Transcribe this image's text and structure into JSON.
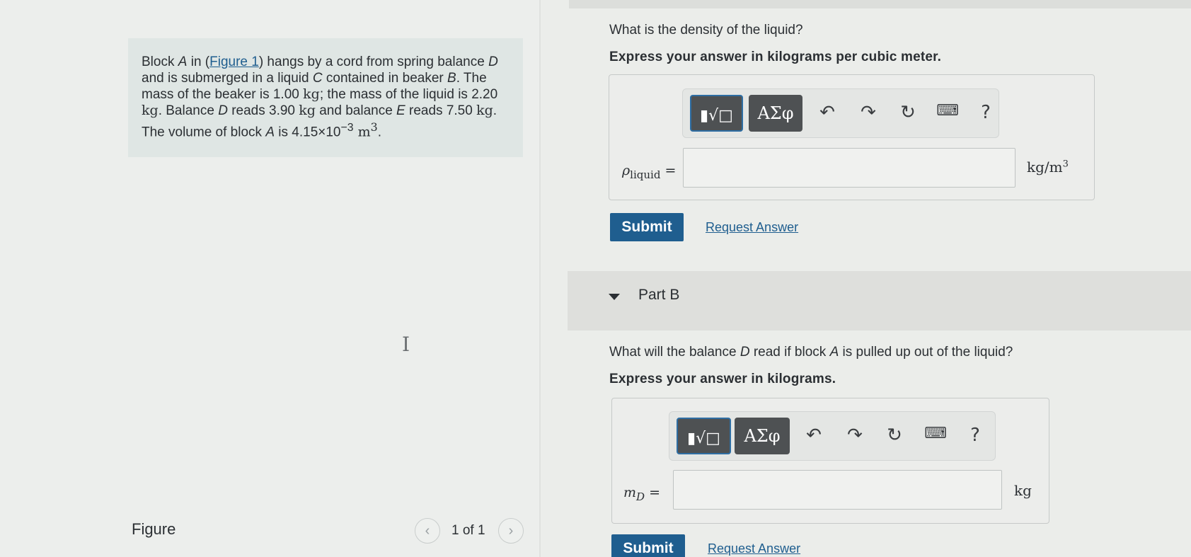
{
  "problem": {
    "t1": "Block ",
    "A1": "A",
    "t2": " in (",
    "figure_link": "Figure 1",
    "t3": ") hangs by a cord from spring balance ",
    "D1": "D",
    "t4": " and is submerged in a liquid ",
    "C1": "C",
    "t5": " contained in beaker ",
    "B1": "B",
    "t6": ". The mass of the beaker is 1.00 ",
    "u1": "kg",
    "t7": "; the mass of the liquid is 2.20 ",
    "u2": "kg",
    "t8": ". Balance ",
    "D2": "D",
    "t9": " reads 3.90 ",
    "u3": "kg",
    "t10": " and balance ",
    "E1": "E",
    "t11": " reads 7.50 ",
    "u4": "kg",
    "t12": ". The volume of block ",
    "A2": "A",
    "t13": " is 4.15×10",
    "exp": "−3",
    "u5": " m",
    "u5exp": "3",
    "t14": "."
  },
  "figure": {
    "label": "Figure",
    "pager_text": "1 of 1",
    "prev_icon": "chevron-left-icon",
    "next_icon": "chevron-right-icon"
  },
  "partA": {
    "question": "What is the density of the liquid?",
    "instruction": "Express your answer in kilograms per cubic meter.",
    "var_symbol": "ρ",
    "var_sub": "liquid",
    "equals": "=",
    "unit_base": "kg/m",
    "unit_exp": "3",
    "input_value": "",
    "submit": "Submit",
    "request": "Request Answer"
  },
  "partB": {
    "title": "Part B",
    "question_pre": "What will the balance ",
    "question_D": "D",
    "question_mid": " read if block ",
    "question_A": "A",
    "question_post": " is pulled up out of the liquid?",
    "instruction": "Express your answer in kilograms.",
    "var_symbol": "m",
    "var_sub": "D",
    "equals": "=",
    "unit": "kg",
    "input_value": "",
    "submit": "Submit",
    "request": "Request Answer"
  },
  "toolbar": {
    "greek": "ΑΣφ",
    "help": "?"
  },
  "cursor_glyph": "I"
}
